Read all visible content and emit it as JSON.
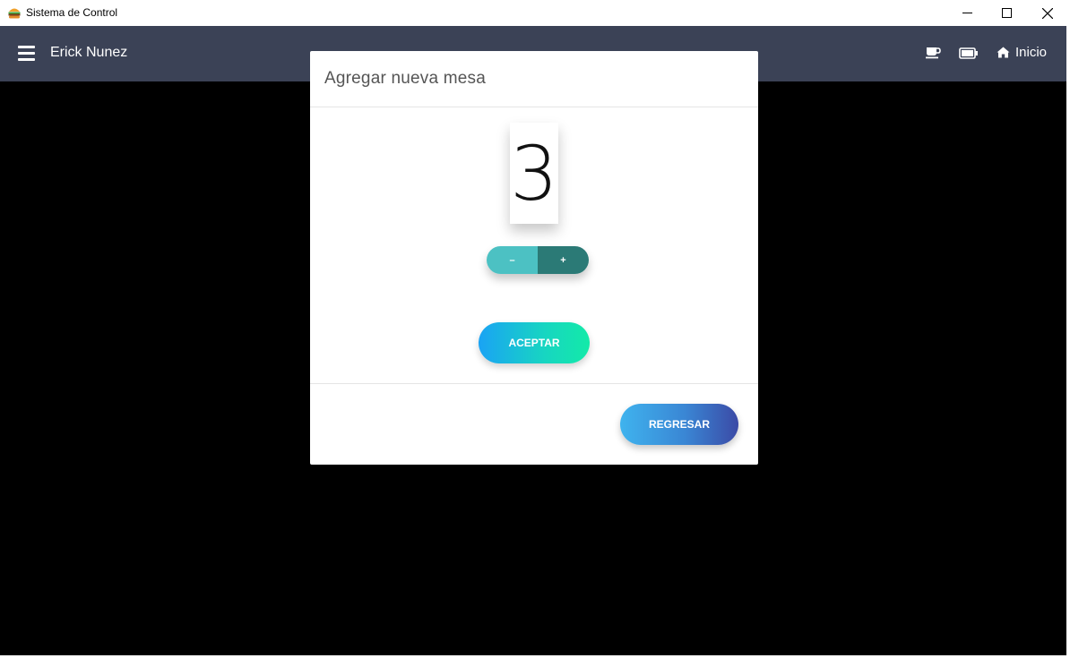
{
  "window": {
    "title": "Sistema de Control",
    "app_icon": "burger-icon",
    "controls": [
      "minimize-icon",
      "maximize-icon",
      "close-icon"
    ]
  },
  "header": {
    "user_name": "Erick Nunez",
    "menu_icon": "hamburger-menu-icon",
    "icons": [
      "coffee-cup-icon",
      "battery-icon"
    ],
    "home_label": "Inicio",
    "home_icon": "home-icon",
    "background": "#3b4256"
  },
  "modal": {
    "title": "Agregar nueva mesa",
    "counter_value": "3",
    "minus_label": "–",
    "plus_label": "+",
    "accept_label": "ACEPTAR",
    "back_label": "REGRESAR",
    "colors": {
      "minus": "#4cc1c3",
      "plus": "#2b7a76",
      "accept_gradient": [
        "#1aa3f4",
        "#13eaa8"
      ],
      "back_gradient": [
        "#3fb3ee",
        "#3b4aa6"
      ]
    }
  }
}
